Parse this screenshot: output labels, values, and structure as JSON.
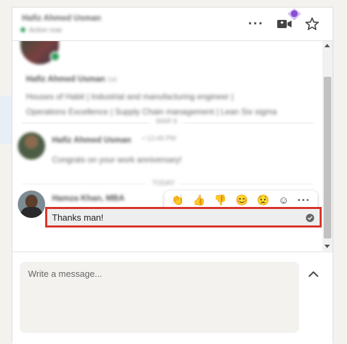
{
  "header": {
    "contact_name": "Hafiz Ahmed Usman",
    "status_text": "Active now",
    "more_icon": "more-options-icon",
    "video_icon": "video-call-icon",
    "star_icon": "star-icon"
  },
  "thread": {
    "profile_card": {
      "name": "Hafiz Ahmed Usman",
      "degree": "1st",
      "headline_line1": "Houses of Habit | Industrial and manufacturing engineer |",
      "headline_line2": "Operations Excellence | Supply Chain management | Lean Six sigma"
    },
    "divider_label": "MAR 9",
    "message1": {
      "sender": "Hafiz Ahmed Usman",
      "time": "• 12:49 PM",
      "text": "Congrats on your work anniversary!"
    },
    "divider2_label": "TODAY",
    "message2": {
      "sender": "Hamza Khan, MBA",
      "text": "Thanks man!"
    },
    "reactions": [
      "clap",
      "thumbs-up",
      "thumbs-down",
      "smile",
      "sad",
      "add-reaction"
    ]
  },
  "composer": {
    "placeholder": "Write a message..."
  },
  "colors": {
    "highlight_border": "#d7332a",
    "online_dot": "#2e9e5b",
    "premium_gem": "#8a4fd8"
  }
}
